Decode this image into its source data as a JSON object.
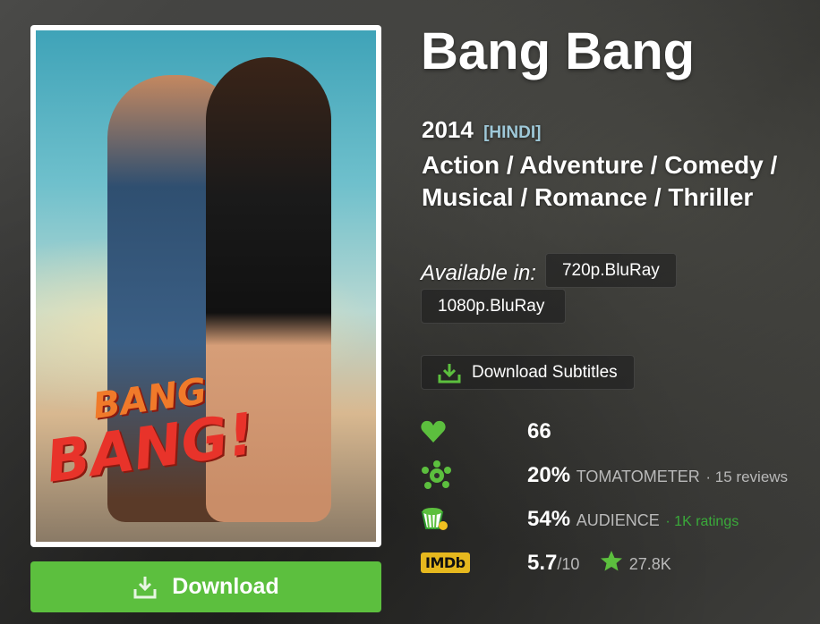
{
  "movie": {
    "title": "Bang Bang",
    "year": "2014",
    "language": "[HINDI]",
    "genres": "Action / Adventure / Comedy / Musical / Romance / Thriller"
  },
  "poster": {
    "art_line1": "BANG",
    "art_line2": "BANG!"
  },
  "available": {
    "label": "Available in:",
    "qualities": [
      "720p.BluRay",
      "1080p.BluRay"
    ]
  },
  "subtitles": {
    "label": "Download Subtitles",
    "icon": "download-icon"
  },
  "stats": {
    "likes": {
      "icon": "heart-icon",
      "value": "66",
      "color": "#5cbf3e"
    },
    "tomatometer": {
      "icon": "splat-icon",
      "value": "20%",
      "label": "TOMATOMETER",
      "reviews": "· 15 reviews",
      "color": "#5cbf3e"
    },
    "audience": {
      "icon": "popcorn-icon",
      "value": "54%",
      "label": "AUDIENCE",
      "ratings": "· 1K ratings"
    },
    "imdb": {
      "badge": "IMDb",
      "value": "5.7",
      "scale": "/10",
      "votes": "27.8K",
      "icon": "star-icon"
    }
  },
  "download_button": {
    "label": "Download",
    "color": "#5cbf3e"
  }
}
